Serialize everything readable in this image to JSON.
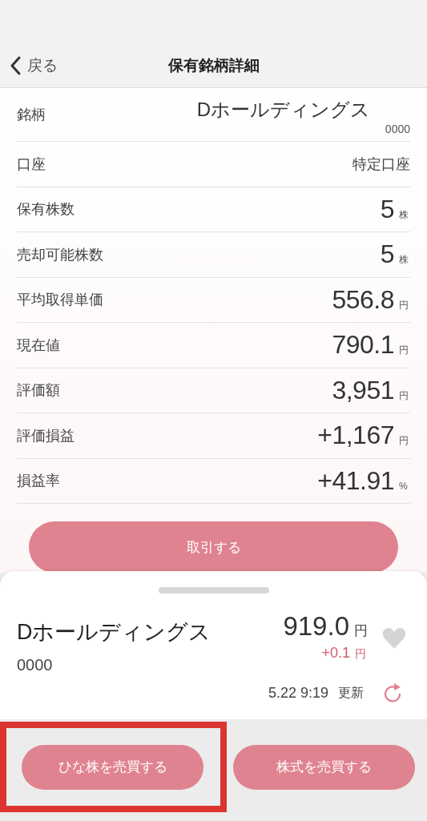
{
  "header": {
    "back_label": "戻る",
    "title": "保有銘柄詳細"
  },
  "rows": [
    {
      "kind": "name",
      "label": "銘柄",
      "value": "Dホールディングス",
      "code": "0000"
    },
    {
      "kind": "text",
      "label": "口座",
      "value": "特定口座"
    },
    {
      "kind": "number",
      "label": "保有株数",
      "value": "5",
      "unit": "株"
    },
    {
      "kind": "number",
      "label": "売却可能株数",
      "value": "5",
      "unit": "株"
    },
    {
      "kind": "number",
      "label": "平均取得単価",
      "value": "556.8",
      "unit": "円"
    },
    {
      "kind": "number",
      "label": "現在値",
      "value": "790.1",
      "unit": "円"
    },
    {
      "kind": "number",
      "label": "評価額",
      "value": "3,951",
      "unit": "円"
    },
    {
      "kind": "number",
      "label": "評価損益",
      "value": "+1,167",
      "unit": "円"
    },
    {
      "kind": "number",
      "label": "損益率",
      "value": "+41.91",
      "unit": "%"
    }
  ],
  "trade_button": "取引する",
  "quote": {
    "name": "Dホールディングス",
    "code": "0000",
    "price": "919.0",
    "price_unit": "円",
    "change": "+0.1",
    "change_unit": "円",
    "favorite": false,
    "updated": "5.22 9:19",
    "update_label": "更新"
  },
  "actions": [
    {
      "label": "ひな株を売買する",
      "highlighted": true
    },
    {
      "label": "株式を売買する",
      "highlighted": false
    }
  ]
}
